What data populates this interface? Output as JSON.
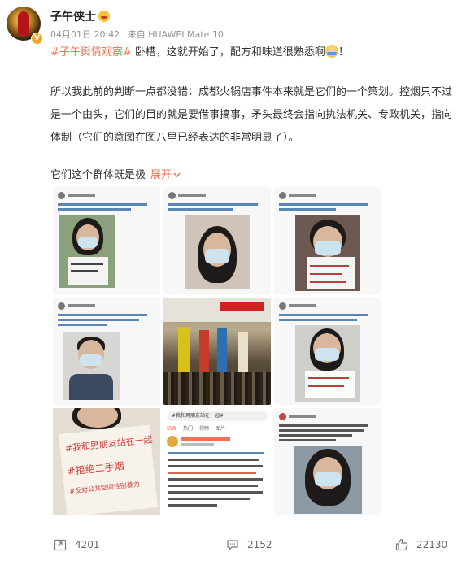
{
  "user": {
    "name": "子午侠士",
    "verified_icon": "yellow-v-badge",
    "name_emoji": "smile-emoji"
  },
  "meta": {
    "date": "04月01日 20:42",
    "source_label": "来自 HUAWEI Mate 10"
  },
  "post": {
    "topic": "#子午舆情观察#",
    "line1": " 卧槽，这就开始了，配方和味道很熟悉啊",
    "line1_end": "！",
    "lines": [
      "所以我此前的判断一点都没错：成都火锅店事件本来就是它们的一个策划。控烟只不过",
      "是一个由头，它们的目的就是要借事搞事，矛头最终会指向执法机关、专政机关，指向",
      "体制（它们的意图在图八里已经表达的非常明显了）。"
    ],
    "tail_text": "它们这个群体既是极",
    "expand_label": "展开",
    "expand_icon": "chevron-down-icon"
  },
  "images": [
    {
      "id": 1,
      "kind": "tweet-portrait"
    },
    {
      "id": 2,
      "kind": "tweet-selfie"
    },
    {
      "id": 3,
      "kind": "tweet-sign"
    },
    {
      "id": 4,
      "kind": "tweet-portrait"
    },
    {
      "id": 5,
      "kind": "crowd-photo"
    },
    {
      "id": 6,
      "kind": "tweet-sign"
    },
    {
      "id": 7,
      "kind": "handwritten-sign",
      "sign_lines": [
        "#我和男朋友站在一起",
        "#拒绝二手烟",
        "#反对公共空间性别暴力"
      ]
    },
    {
      "id": 8,
      "kind": "weibo-screenshot",
      "search_text": "#我和男朋友站在一起#",
      "tabs": [
        "综合",
        "热门",
        "视频",
        "图片"
      ]
    },
    {
      "id": 9,
      "kind": "tweet-portrait"
    }
  ],
  "actions": {
    "repost_count": "4201",
    "comment_count": "2152",
    "like_count": "22130"
  },
  "colors": {
    "accent": "#eb7350",
    "meta_gray": "#939393",
    "text": "#333333"
  }
}
